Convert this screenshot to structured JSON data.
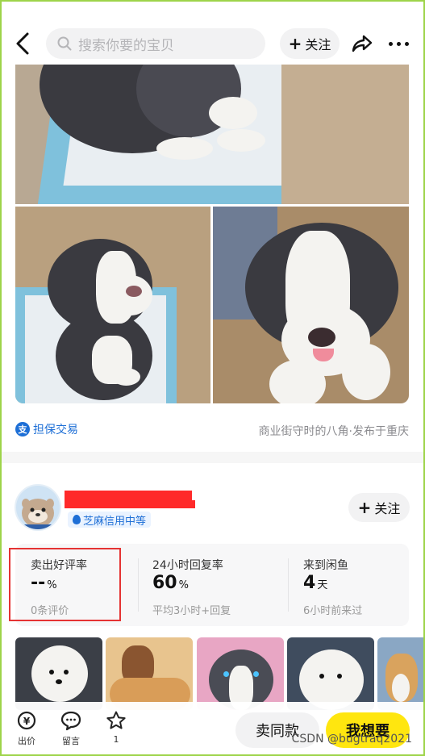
{
  "header": {
    "search_placeholder": "搜索你要的宝贝",
    "follow_label": "关注"
  },
  "item": {
    "guarantee_label": "担保交易",
    "guarantee_icon_text": "支",
    "location_text": "商业街守时的八角·发布于重庆"
  },
  "seller": {
    "credit_label": "芝麻信用中等",
    "follow_label": "关注"
  },
  "stats": [
    {
      "title": "卖出好评率",
      "value": "--",
      "unit": "%",
      "sub": "0条评价"
    },
    {
      "title": "24小时回复率",
      "value": "60",
      "unit": "%",
      "sub": "平均3小时+回复"
    },
    {
      "title": "来到闲鱼",
      "value": "4",
      "unit": "天",
      "sub": "6小时前来过"
    }
  ],
  "bottom_bar": {
    "items": [
      {
        "label": "出价",
        "icon": "yen-coin-icon"
      },
      {
        "label": "留言",
        "icon": "chat-bubble-icon"
      },
      {
        "label": "1",
        "icon": "star-icon"
      }
    ],
    "sell_same_label": "卖同款",
    "want_label": "我想要"
  },
  "watermark": "CSDN @bugtraq2021",
  "colors": {
    "accent_yellow": "#ffe60f",
    "link_blue": "#1e6fd6",
    "highlight_red": "#e53333",
    "frame_green": "#9ed44a"
  }
}
